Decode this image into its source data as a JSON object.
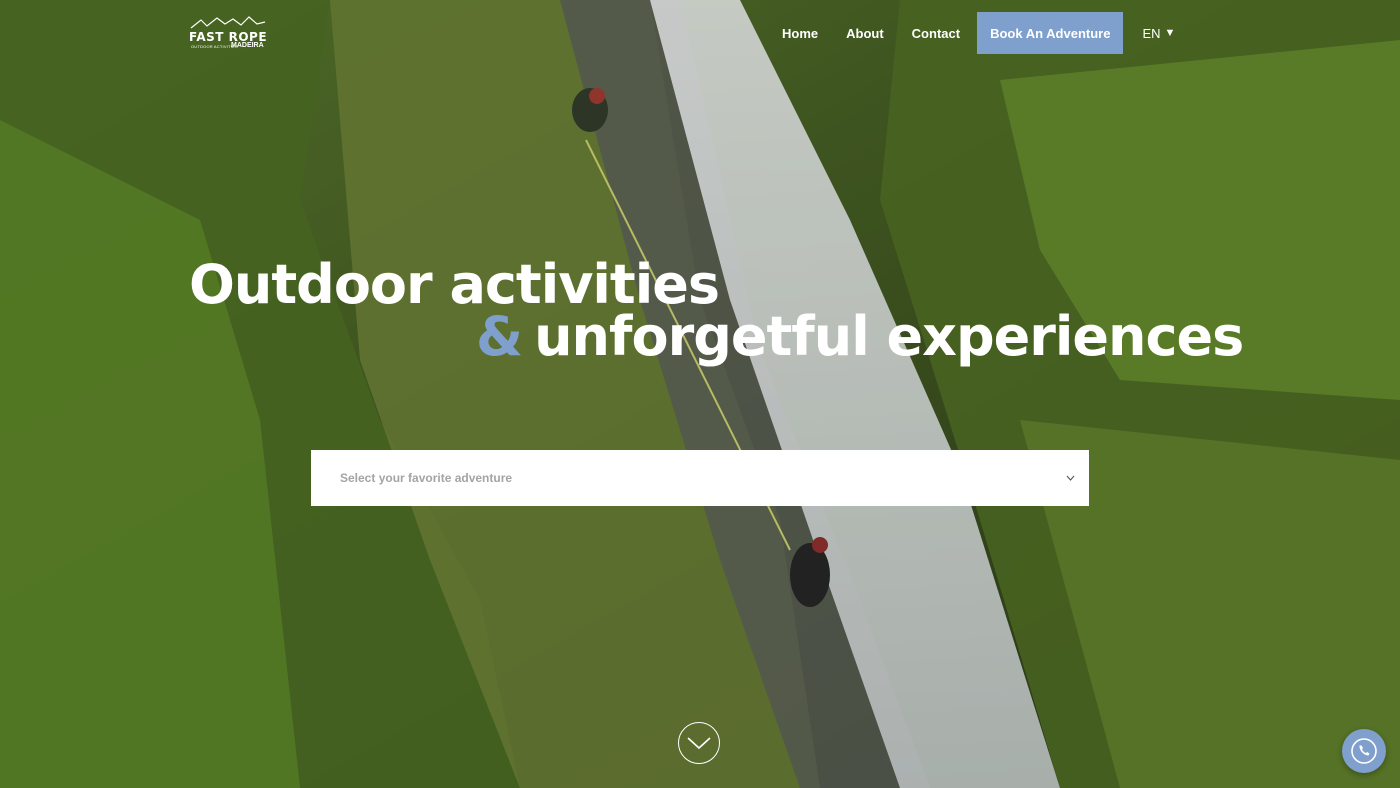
{
  "brand": {
    "logo_text": "FAST ROPE",
    "logo_tagline": "OUTDOOR ACTIVITIES",
    "logo_region": "MADEIRA"
  },
  "nav": {
    "home": "Home",
    "about": "About",
    "contact": "Contact",
    "book": "Book An Adventure",
    "language": "EN"
  },
  "hero": {
    "line1": "Outdoor activities",
    "ampersand": "&",
    "line2": "unforgetful experiences"
  },
  "adventure_select": {
    "placeholder": "Select your favorite adventure"
  },
  "icons": {
    "scroll": "chevron-down-icon",
    "call": "phone-icon"
  },
  "colors": {
    "accent": "#7f9fcd",
    "text": "#ffffff"
  }
}
